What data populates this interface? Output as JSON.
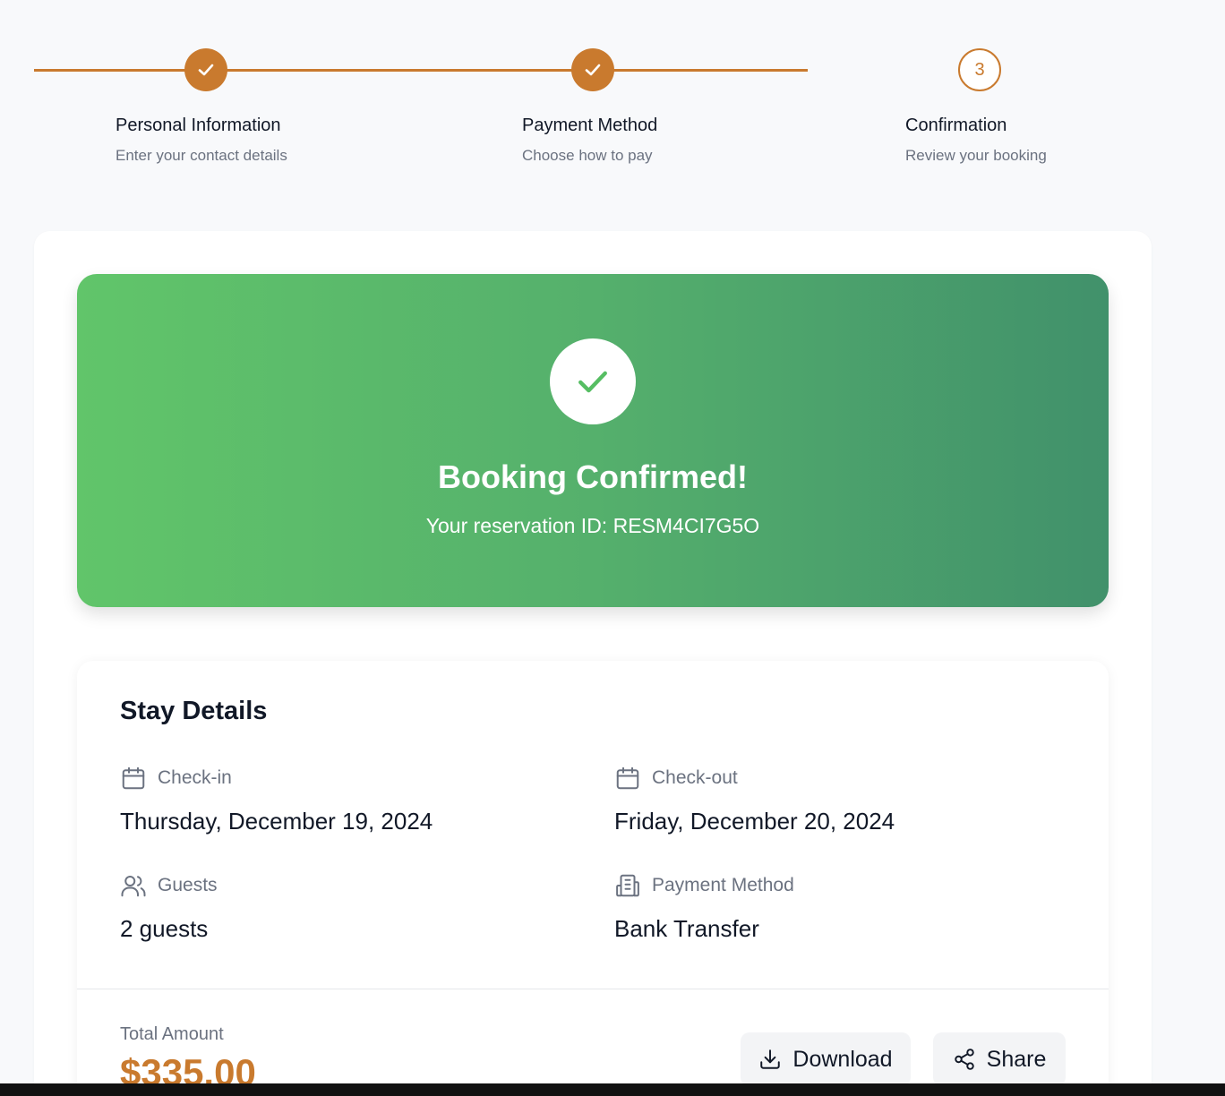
{
  "stepper": {
    "steps": [
      {
        "title": "Personal Information",
        "subtitle": "Enter your contact details",
        "state": "done"
      },
      {
        "title": "Payment Method",
        "subtitle": "Choose how to pay",
        "state": "done"
      },
      {
        "title": "Confirmation",
        "subtitle": "Review your booking",
        "state": "current",
        "number": "3"
      }
    ],
    "accent_color": "#c97a2e"
  },
  "banner": {
    "title": "Booking Confirmed!",
    "reservation_text": "Your reservation ID: RESM4CI7G5O",
    "icon": "check-icon"
  },
  "stay_details": {
    "title": "Stay Details",
    "check_in": {
      "label": "Check-in",
      "value": "Thursday, December 19, 2024",
      "icon": "calendar-icon"
    },
    "check_out": {
      "label": "Check-out",
      "value": "Friday, December 20, 2024",
      "icon": "calendar-icon"
    },
    "guests": {
      "label": "Guests",
      "value": "2 guests",
      "icon": "users-icon"
    },
    "payment": {
      "label": "Payment Method",
      "value": "Bank Transfer",
      "icon": "bank-icon"
    }
  },
  "total": {
    "label": "Total Amount",
    "value": "$335.00"
  },
  "actions": {
    "download_label": "Download",
    "share_label": "Share"
  }
}
